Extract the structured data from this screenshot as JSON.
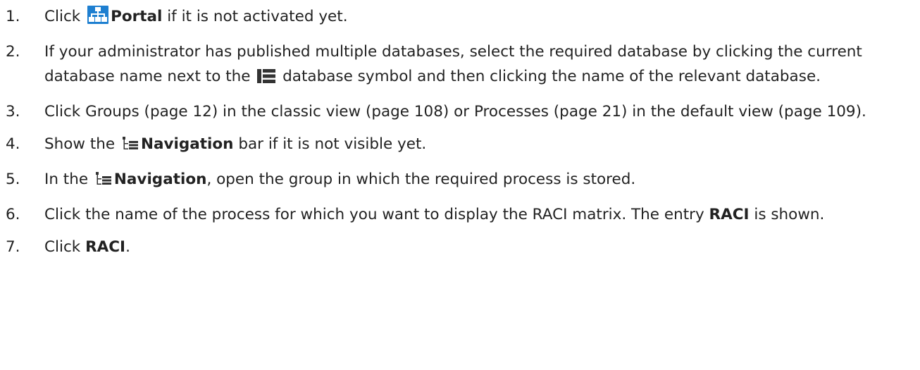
{
  "steps": [
    {
      "number": "1.",
      "pre": "Click ",
      "icon": "portal-icon",
      "bold": "Portal",
      "post": " if it is not activated yet."
    },
    {
      "number": "2.",
      "pre": "If your administrator has published multiple databases, select the required database by clicking the current database name next to the ",
      "icon": "database-icon",
      "post": " database symbol and then clicking the name of the relevant database."
    },
    {
      "number": "3.",
      "text": "Click Groups (page 12) in the classic view (page 108) or Processes (page 21) in the default view (page 109)."
    },
    {
      "number": "4.",
      "pre": "Show the ",
      "icon": "navigation-icon",
      "bold": "Navigation",
      "post": " bar if it is not visible yet."
    },
    {
      "number": "5.",
      "pre": "In the ",
      "icon": "navigation-icon",
      "bold": "Navigation",
      "post": ", open the group in which the required process is stored."
    },
    {
      "number": "6.",
      "pre": "Click the name of the process for which you want to display the RACI matrix. The entry ",
      "bold": "RACI",
      "post": " is shown."
    },
    {
      "number": "7.",
      "pre": "Click ",
      "bold": "RACI",
      "post": "."
    }
  ],
  "colors": {
    "text": "#222222",
    "portal_icon": "#1e7fd0",
    "icon_dark": "#333333"
  }
}
